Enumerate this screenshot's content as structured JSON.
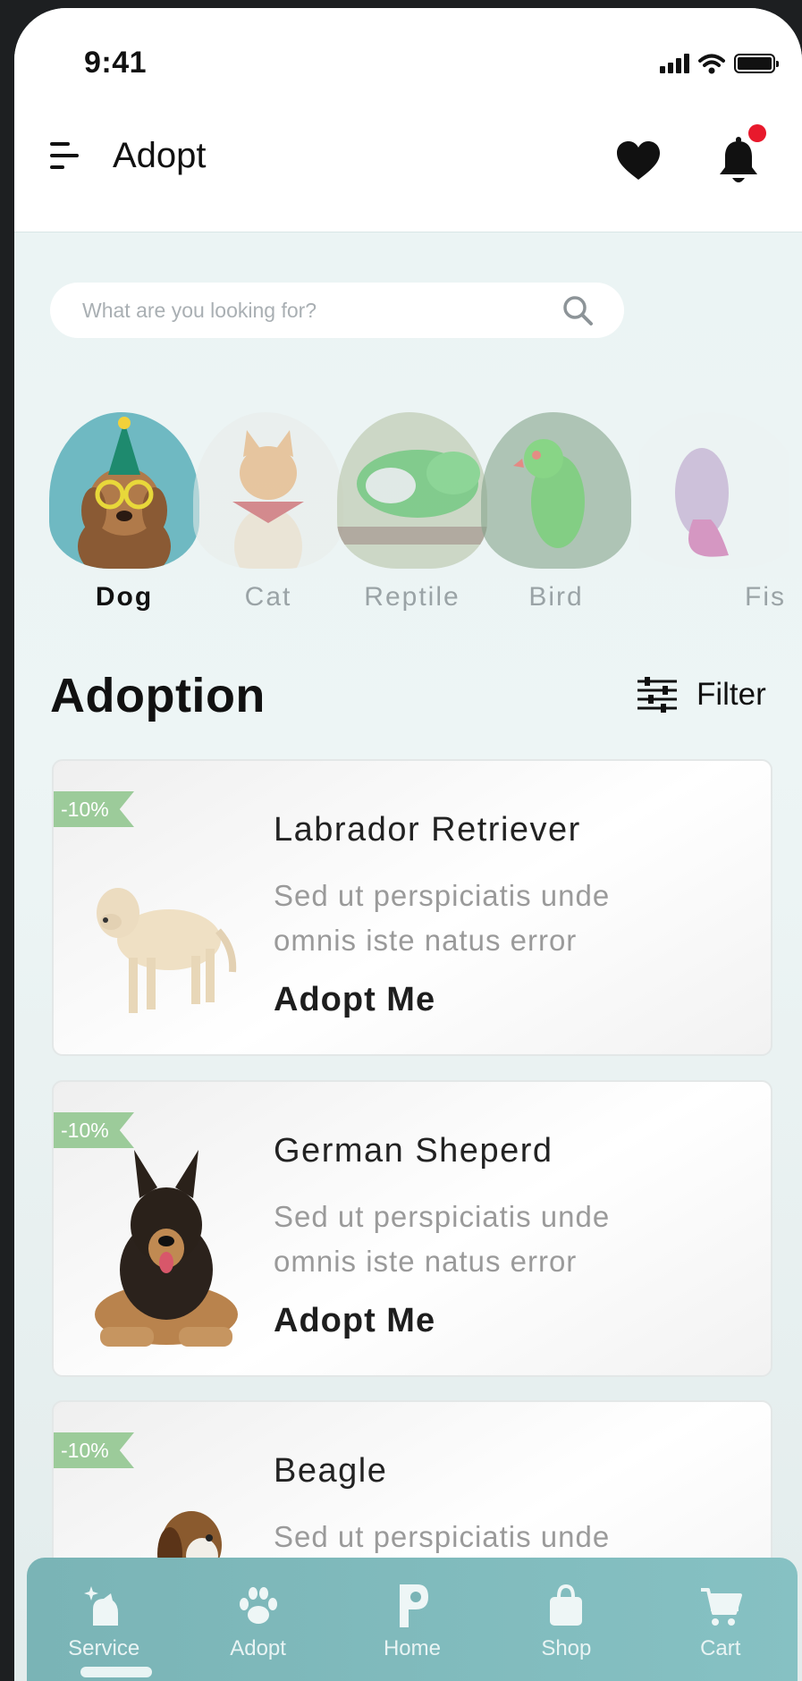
{
  "status_bar": {
    "time": "9:41"
  },
  "header": {
    "title": "Adopt"
  },
  "search": {
    "placeholder": "What are you looking for?"
  },
  "categories": [
    {
      "label": "Dog",
      "active": true
    },
    {
      "label": "Cat",
      "active": false
    },
    {
      "label": "Reptile",
      "active": false
    },
    {
      "label": "Bird",
      "active": false
    },
    {
      "label": "Fis",
      "active": false
    }
  ],
  "section": {
    "title": "Adoption",
    "filter_label": "Filter"
  },
  "cards": [
    {
      "badge": "-10%",
      "title": "Labrador Retriever",
      "desc_line1": "Sed ut perspiciatis unde",
      "desc_line2": "omnis iste natus error",
      "cta": "Adopt Me"
    },
    {
      "badge": "-10%",
      "title": "German Sheperd",
      "desc_line1": "Sed ut perspiciatis unde",
      "desc_line2": "omnis iste natus error",
      "cta": "Adopt Me"
    },
    {
      "badge": "-10%",
      "title": "Beagle",
      "desc_line1": "Sed ut perspiciatis unde",
      "desc_line2": "",
      "cta": ""
    }
  ],
  "nav": [
    {
      "label": "Service",
      "icon": "pet-service-icon"
    },
    {
      "label": "Adopt",
      "icon": "paw-icon"
    },
    {
      "label": "Home",
      "icon": "home-p-icon"
    },
    {
      "label": "Shop",
      "icon": "shopping-bag-icon"
    },
    {
      "label": "Cart",
      "icon": "cart-icon"
    }
  ],
  "colors": {
    "accent": "#7ab4b6",
    "badge": "#9ccb9a",
    "notification": "#e8192c",
    "background": "#eaf3f3"
  }
}
